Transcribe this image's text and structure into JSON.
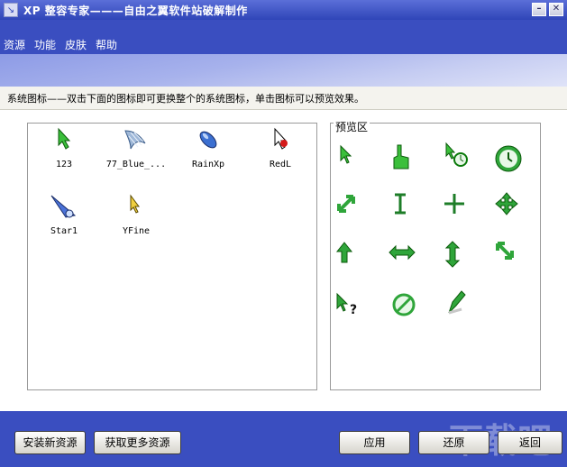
{
  "window": {
    "title": "XP 整容专家———自由之翼软件站破解制作"
  },
  "menu": [
    "资源",
    "功能",
    "皮肤",
    "帮助"
  ],
  "description": "系统图标——双击下面的图标即可更换整个的系统图标，单击图标可以预览效果。",
  "resources": [
    {
      "label": "123",
      "icon": "green-arrow-cursor-icon"
    },
    {
      "label": "77_Blue_...",
      "icon": "blue-bird-icon"
    },
    {
      "label": "RainXp",
      "icon": "raindrop-icon"
    },
    {
      "label": "RedL",
      "icon": "red-dot-cursor-icon"
    },
    {
      "label": "Star1",
      "icon": "blue-comet-icon"
    },
    {
      "label": "YFine",
      "icon": "yellow-arrow-cursor-icon"
    }
  ],
  "preview": {
    "label": "预览区",
    "icons": [
      "arrow-cursor-icon",
      "hand-cursor-icon",
      "busy-arrow-cursor-icon",
      "clock-cursor-icon",
      "resize-diagonal-icon",
      "text-beam-cursor-icon",
      "crosshair-cursor-icon",
      "move-cursor-icon",
      "up-arrow-cursor-icon",
      "resize-horizontal-icon",
      "resize-vertical-icon",
      "resize-diagonal2-icon",
      "help-cursor-icon",
      "unavailable-cursor-icon",
      "pen-cursor-icon"
    ]
  },
  "buttons": {
    "install": "安装新资源",
    "more": "获取更多资源",
    "apply": "应用",
    "restore": "还原",
    "back": "返回"
  },
  "watermark": "下载吧",
  "colors": {
    "titlebar": "#2f45b8",
    "menubar": "#3a4ec0",
    "accent_green": "#2fa53a"
  }
}
